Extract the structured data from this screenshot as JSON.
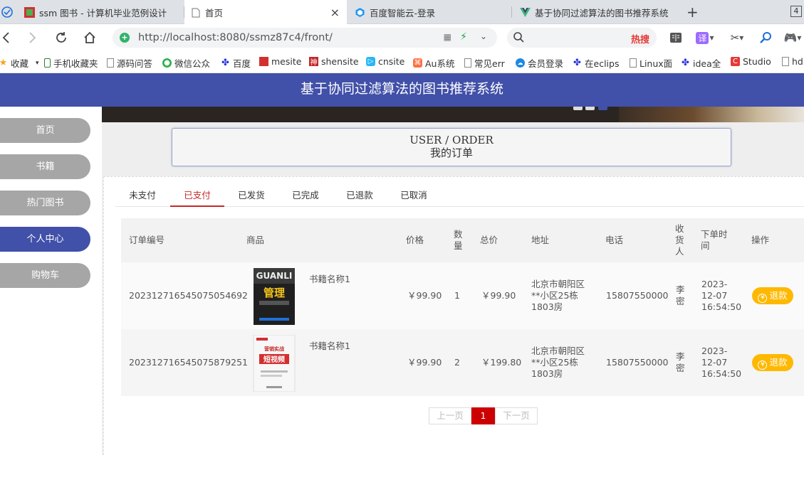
{
  "browser": {
    "tabs": [
      {
        "label": "ssm 图书 - 计算机毕业范例设计",
        "active": false
      },
      {
        "label": "首页",
        "active": true
      },
      {
        "label": "百度智能云-登录",
        "active": false
      },
      {
        "label": "基于协同过滤算法的图书推荐系统",
        "active": false
      }
    ],
    "tab_count": "4",
    "url": "http://localhost:8080/ssmz87c4/front/",
    "search_hot": "热搜",
    "bookmarks": [
      "收藏",
      "手机收藏夹",
      "源码问答",
      "微信公众",
      "百度",
      "mesite",
      "shensite",
      "cnsite",
      "Au系统",
      "常见err",
      "会员登录",
      "在eclips",
      "Linux面",
      "idea全",
      "Studio",
      "hd"
    ]
  },
  "header": {
    "title": "基于协同过滤算法的图书推荐系统"
  },
  "sidebar": {
    "items": [
      {
        "label": "首页",
        "active": false
      },
      {
        "label": "书籍",
        "active": false
      },
      {
        "label": "热门图书",
        "active": false
      },
      {
        "label": "个人中心",
        "active": true
      },
      {
        "label": "购物车",
        "active": false
      }
    ]
  },
  "page_title": {
    "en": "USER / ORDER",
    "cn": "我的订单"
  },
  "order_tabs": [
    {
      "label": "未支付",
      "active": false
    },
    {
      "label": "已支付",
      "active": true
    },
    {
      "label": "已发货",
      "active": false
    },
    {
      "label": "已完成",
      "active": false
    },
    {
      "label": "已退款",
      "active": false
    },
    {
      "label": "已取消",
      "active": false
    }
  ],
  "table": {
    "headers": {
      "order_no": "订单编号",
      "product": "商品",
      "price": "价格",
      "qty": "数量",
      "total": "总价",
      "address": "地址",
      "phone": "电话",
      "receiver": "收货人",
      "time": "下单时间",
      "action": "操作"
    },
    "rows": [
      {
        "order_no": "20231271654507505469­2",
        "product": "书籍名称1",
        "price": "￥99.90",
        "qty": "1",
        "total": "￥99.90",
        "address": "北京市朝阳区**小区25栋1803房",
        "phone": "15807550000",
        "receiver": "李密",
        "time": "2023-12-07 16:54:50",
        "action": "退款",
        "cover": "管理"
      },
      {
        "order_no": "20231271654507587925­1",
        "product": "书籍名称1",
        "price": "￥99.90",
        "qty": "2",
        "total": "￥199.80",
        "address": "北京市朝阳区**小区25栋1803房",
        "phone": "15807550000",
        "receiver": "李密",
        "time": "2023-12-07 16:54:50",
        "action": "退款",
        "cover": "短视频"
      }
    ]
  },
  "pager": {
    "prev": "上一页",
    "current": "1",
    "next": "下一页"
  },
  "colors": {
    "primary": "#4150a8",
    "accent": "#c62828",
    "refund": "#ffb800"
  }
}
